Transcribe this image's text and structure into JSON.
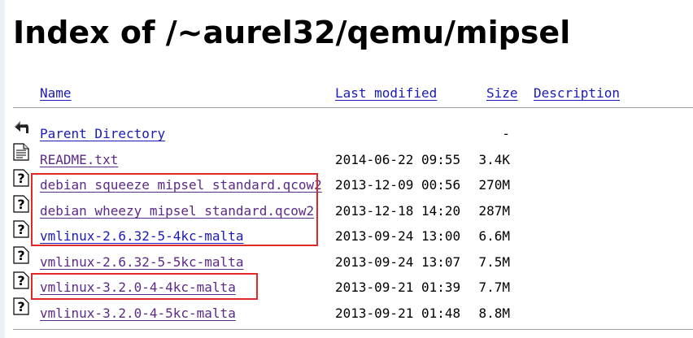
{
  "page": {
    "title": "Index of /~aurel32/qemu/mipsel"
  },
  "columns": {
    "name": "Name",
    "last_modified": "Last modified",
    "size": "Size",
    "description": "Description"
  },
  "rows": [
    {
      "name": "Parent Directory",
      "date": "",
      "size": "-",
      "icon": "back-arrow-icon"
    },
    {
      "name": "README.txt",
      "date": "2014-06-22 09:55",
      "size": "3.4K",
      "icon": "text-file-icon"
    },
    {
      "name": "debian_squeeze_mipsel_standard.qcow2",
      "date": "2013-12-09 00:56",
      "size": "270M",
      "icon": "unknown-file-icon"
    },
    {
      "name": "debian_wheezy_mipsel_standard.qcow2",
      "date": "2013-12-18 14:20",
      "size": "287M",
      "icon": "unknown-file-icon"
    },
    {
      "name": "vmlinux-2.6.32-5-4kc-malta",
      "date": "2013-09-24 13:00",
      "size": "6.6M",
      "icon": "unknown-file-icon"
    },
    {
      "name": "vmlinux-2.6.32-5-5kc-malta",
      "date": "2013-09-24 13:07",
      "size": "7.5M",
      "icon": "unknown-file-icon"
    },
    {
      "name": "vmlinux-3.2.0-4-4kc-malta",
      "date": "2013-09-21 01:39",
      "size": "7.7M",
      "icon": "unknown-file-icon"
    },
    {
      "name": "vmlinux-3.2.0-4-5kc-malta",
      "date": "2013-09-21 01:48",
      "size": "8.8M",
      "icon": "unknown-file-icon"
    }
  ],
  "colors": {
    "link": "#1a1ab8",
    "visited_link": "#5b2a86",
    "highlight": "#e02828"
  }
}
